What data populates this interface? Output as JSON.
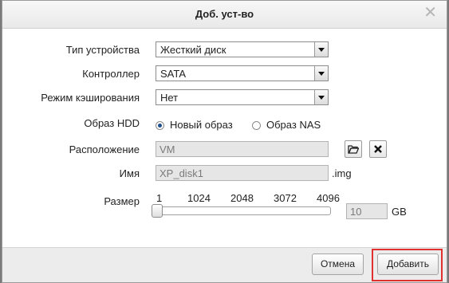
{
  "dialog": {
    "title": "Доб. уст-во",
    "close_glyph": "✕"
  },
  "form": {
    "device_type": {
      "label": "Тип устройства",
      "value": "Жесткий диск"
    },
    "controller": {
      "label": "Контроллер",
      "value": "SATA"
    },
    "cache_mode": {
      "label": "Режим кэширования",
      "value": "Нет"
    },
    "hdd_image": {
      "label": "Образ HDD",
      "options": [
        {
          "label": "Новый образ",
          "checked": true
        },
        {
          "label": "Образ NAS",
          "checked": false
        }
      ]
    },
    "location": {
      "label": "Расположение",
      "value": "VM"
    },
    "name": {
      "label": "Имя",
      "value": "XP_disk1",
      "suffix": ".img"
    },
    "size": {
      "label": "Размер",
      "ticks": [
        "1",
        "1024",
        "2048",
        "3072",
        "4096"
      ],
      "value": "10",
      "unit": "GB",
      "slider_min": 1,
      "slider_max": 4096,
      "slider_value": 10
    }
  },
  "footer": {
    "cancel_label": "Отмена",
    "add_label": "Добавить"
  },
  "icons": {
    "browse": "folder-open-icon",
    "clear": "close-icon"
  },
  "colors": {
    "highlight": "#e03030",
    "radio_selected": "#1f4e8c"
  }
}
